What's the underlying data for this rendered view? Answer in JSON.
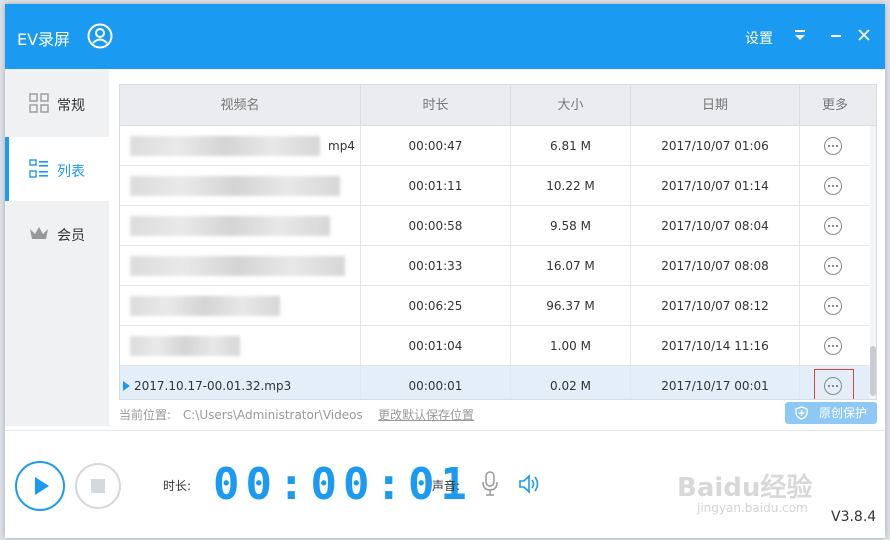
{
  "titlebar": {
    "app_title": "EV录屏",
    "settings_label": "设置"
  },
  "sidebar": {
    "items": [
      {
        "label": "常规",
        "icon": "grid-icon"
      },
      {
        "label": "列表",
        "icon": "list-icon",
        "active": true
      },
      {
        "label": "会员",
        "icon": "crown-icon"
      }
    ]
  },
  "table": {
    "columns": [
      "视频名",
      "时长",
      "大小",
      "日期",
      "更多"
    ],
    "rows": [
      {
        "name": "mp4",
        "duration": "00:00:47",
        "size": "6.81 M",
        "date": "2017/10/07 01:06"
      },
      {
        "name": "",
        "duration": "00:01:11",
        "size": "10.22 M",
        "date": "2017/10/07 01:14"
      },
      {
        "name": "",
        "duration": "00:00:58",
        "size": "9.58 M",
        "date": "2017/10/07 08:04"
      },
      {
        "name": "",
        "duration": "00:01:33",
        "size": "16.07 M",
        "date": "2017/10/07 08:08"
      },
      {
        "name": "",
        "duration": "00:06:25",
        "size": "96.37 M",
        "date": "2017/10/07 08:12"
      },
      {
        "name": "",
        "duration": "00:01:04",
        "size": "1.00 M",
        "date": "2017/10/14 11:16"
      },
      {
        "name": "2017.10.17-00.01.32.mp3",
        "duration": "00:00:01",
        "size": "0.02 M",
        "date": "2017/10/17 00:01",
        "selected": true
      }
    ]
  },
  "location": {
    "label": "当前位置:",
    "path": "C:\\Users\\Administrator\\Videos",
    "change_link": "更改默认保存位置"
  },
  "protect_button": "原创保护",
  "recorder": {
    "duration_label": "时长:",
    "timer": "00:00:01",
    "sound_label": "声音:",
    "version": "V3.8.4"
  },
  "watermark": {
    "text": "Baidu经验",
    "sub": "jingyan.baidu.com"
  },
  "colors": {
    "accent": "#1a9af0",
    "selected_row": "#e3eef8",
    "highlight_border": "#d94545"
  }
}
